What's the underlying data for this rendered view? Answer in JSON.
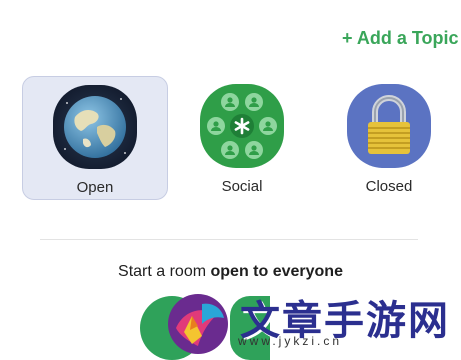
{
  "header": {
    "add_topic_label": "+ Add a Topic"
  },
  "room_types": [
    {
      "label": "Open",
      "icon": "globe-icon",
      "selected": true
    },
    {
      "label": "Social",
      "icon": "people-icon",
      "selected": false
    },
    {
      "label": "Closed",
      "icon": "lock-icon",
      "selected": false
    }
  ],
  "description": {
    "prefix": "Start a room ",
    "emphasis": "open to everyone"
  },
  "watermark": {
    "text": "文章手游网",
    "url": "www.jykzi.cn"
  },
  "colors": {
    "accent": "#3aa65a",
    "selected_bg": "#e4e8f4",
    "social_green": "#2f9e48",
    "closed_blue": "#5b73c2"
  }
}
